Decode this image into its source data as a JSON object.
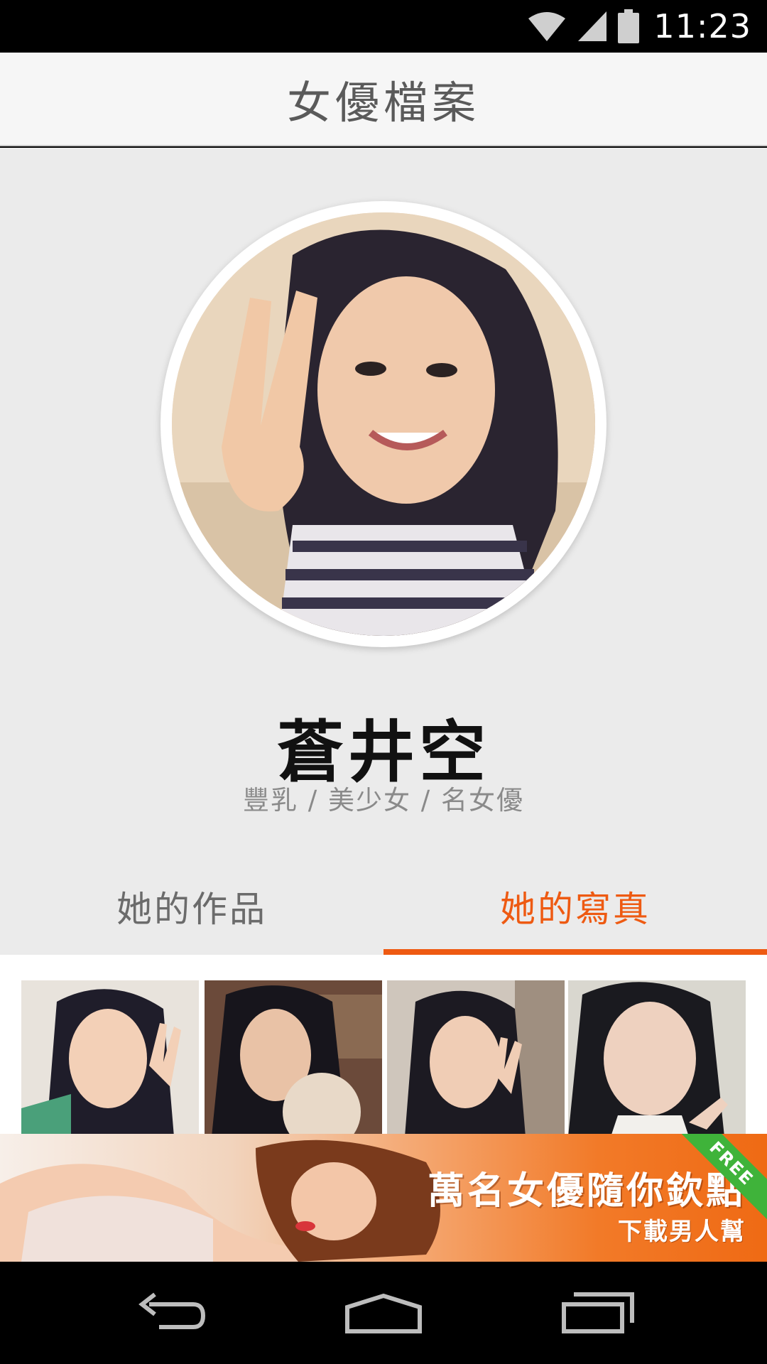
{
  "status_bar": {
    "time": "11:23",
    "icons": [
      "wifi-icon",
      "signal-icon",
      "battery-icon"
    ]
  },
  "header": {
    "title": "女優檔案"
  },
  "profile": {
    "name": "蒼井空",
    "tags": "豐乳 / 美少女 / 名女優"
  },
  "tabs": [
    {
      "label": "她的作品",
      "active": false
    },
    {
      "label": "她的寫真",
      "active": true
    }
  ],
  "colors": {
    "accent": "#ee5a12",
    "header_bg": "#f6f6f6",
    "profile_bg": "#ebebeb"
  },
  "ad": {
    "headline": "萬名女優隨你欽點",
    "subline": "下載男人幫",
    "ribbon": "FREE"
  },
  "nav_bar": {
    "buttons": [
      "back-icon",
      "home-icon",
      "recent-apps-icon"
    ]
  }
}
